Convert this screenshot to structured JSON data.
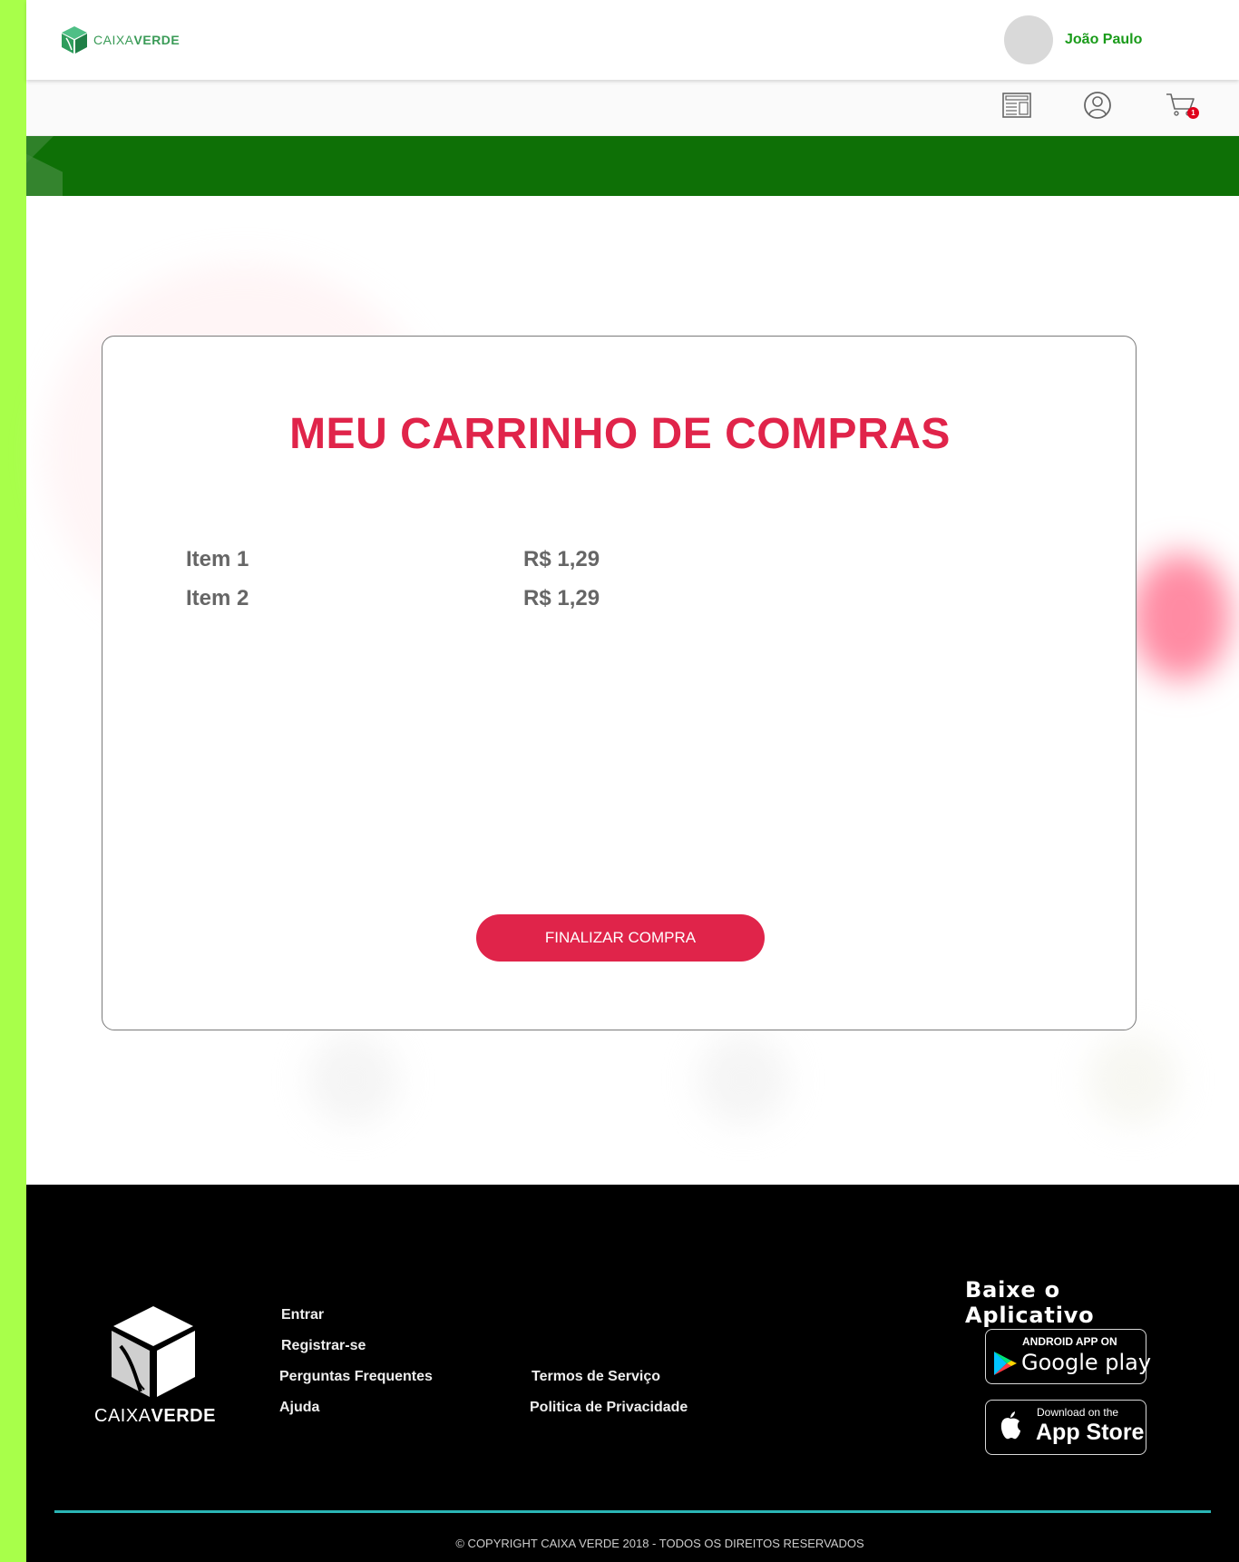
{
  "brand": {
    "name_light": "CAIXA",
    "name_bold": "VERDE",
    "color_primary": "#0e7006",
    "color_accent": "#e0244a",
    "color_user": "#1a9b1a"
  },
  "header": {
    "user_name": "João Paulo"
  },
  "toolbar": {
    "icons": [
      "newspaper-icon",
      "user-circle-icon",
      "cart-icon"
    ],
    "cart_count": "1"
  },
  "cart": {
    "title": "MEU CARRINHO DE COMPRAS",
    "items": [
      {
        "name": "Item 1",
        "price": "R$ 1,29"
      },
      {
        "name": "Item 2",
        "price": "R$ 1,29"
      }
    ],
    "checkout_label": "FINALIZAR COMPRA"
  },
  "footer": {
    "links_col1": [
      "Entrar",
      "Registrar-se",
      "Perguntas Frequentes",
      "Ajuda"
    ],
    "links_col2": [
      "Termos de Serviço",
      "Politica de Privacidade"
    ],
    "app_heading": "Baixe o Aplicativo",
    "google_small": "ANDROID APP ON",
    "google_big": "Google play",
    "apple_small": "Download on the",
    "apple_big": "App Store",
    "copyright": "© COPYRIGHT CAIXA VERDE 2018 - TODOS OS DIREITOS RESERVADOS"
  }
}
